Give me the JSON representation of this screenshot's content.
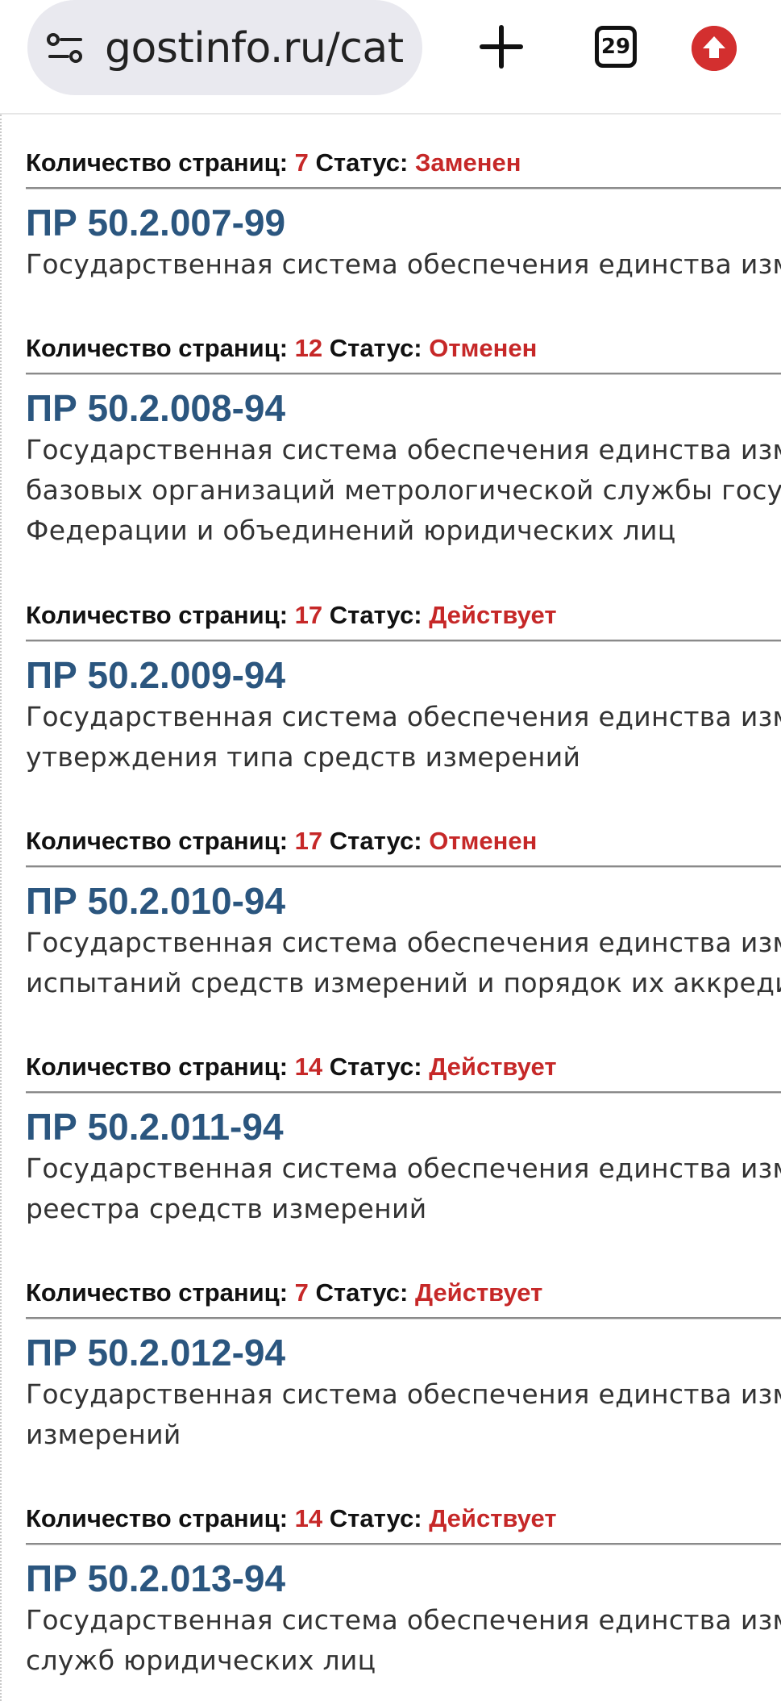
{
  "browser": {
    "url": "gostinfo.ru/catalog",
    "tab_count": "29"
  },
  "labels": {
    "pages": "Количество страниц:",
    "status": "Статус:"
  },
  "entries": [
    {
      "pages": "7",
      "status": "Заменен",
      "code": "ПР 50.2.007-99",
      "desc_lines": [
        "Государственная система обеспечения единства измер"
      ]
    },
    {
      "pages": "12",
      "status": "Отменен",
      "code": "ПР 50.2.008-94",
      "desc_lines": [
        "Государственная система обеспечения единства измер",
        "базовых организаций метрологической службы госуда",
        "Федерации и объединений юридических лиц"
      ]
    },
    {
      "pages": "17",
      "status": "Действует",
      "code": "ПР 50.2.009-94",
      "desc_lines": [
        "Государственная система обеспечения единства измер",
        "утверждения типа средств измерений"
      ]
    },
    {
      "pages": "17",
      "status": "Отменен",
      "code": "ПР 50.2.010-94",
      "desc_lines": [
        "Государственная система обеспечения единства измер",
        "испытаний средств измерений и порядок их аккредита"
      ]
    },
    {
      "pages": "14",
      "status": "Действует",
      "code": "ПР 50.2.011-94",
      "desc_lines": [
        "Государственная система обеспечения единства измер",
        "реестра средств измерений"
      ]
    },
    {
      "pages": "7",
      "status": "Действует",
      "code": "ПР 50.2.012-94",
      "desc_lines": [
        "Государственная система обеспечения единства измер",
        "измерений"
      ]
    },
    {
      "pages": "14",
      "status": "Действует",
      "code": "ПР 50.2.013-94",
      "desc_lines": [
        "Государственная система обеспечения единства измер",
        "служб юридических лиц"
      ]
    }
  ]
}
